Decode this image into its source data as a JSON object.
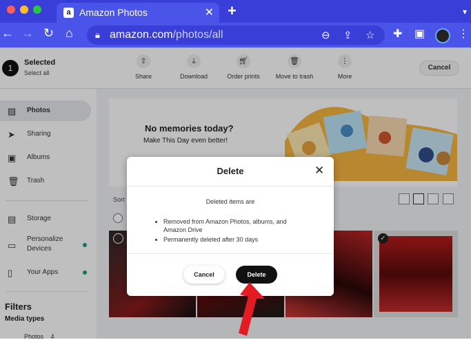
{
  "browser": {
    "tab_title": "Amazon Photos",
    "tab_favicon": "a",
    "url_host": "amazon.com",
    "url_path": "/photos/all"
  },
  "colors": {
    "chrome": "#3a3ed8",
    "toolbar": "#4b54e8",
    "accent_dot": "#1a9e82",
    "annotation_arrow": "#e31b23"
  },
  "actionbar": {
    "selected_count": "1",
    "selected_title": "Selected",
    "select_all": "Select all",
    "actions": [
      {
        "label": "Share",
        "icon": "share-icon"
      },
      {
        "label": "Download",
        "icon": "download-icon"
      },
      {
        "label": "Order prints",
        "icon": "cart-icon"
      },
      {
        "label": "Move to trash",
        "icon": "trash-icon"
      },
      {
        "label": "More",
        "icon": "more-icon"
      }
    ],
    "cancel": "Cancel"
  },
  "sidebar": {
    "items": [
      {
        "label": "Photos",
        "icon": "photo-icon"
      },
      {
        "label": "Sharing",
        "icon": "send-icon"
      },
      {
        "label": "Albums",
        "icon": "album-icon"
      },
      {
        "label": "Trash",
        "icon": "trash-icon"
      },
      {
        "label": "Storage",
        "icon": "storage-icon"
      },
      {
        "label": "Personalize",
        "label2": "Devices",
        "icon": "device-icon"
      },
      {
        "label": "Your Apps",
        "icon": "phone-icon"
      }
    ],
    "filters": "Filters",
    "media_types": "Media types",
    "photos_filter": "Photos",
    "photos_count": "4"
  },
  "main": {
    "memories_title": "No memories today?",
    "memories_sub": "Make This Day even better!",
    "sort_label": "Sort"
  },
  "modal": {
    "title": "Delete",
    "intro": "Deleted items are",
    "bullets": [
      "Removed from Amazon Photos, albums, and Amazon Drive",
      "Permanently deleted after 30 days"
    ],
    "cancel": "Cancel",
    "delete": "Delete"
  }
}
